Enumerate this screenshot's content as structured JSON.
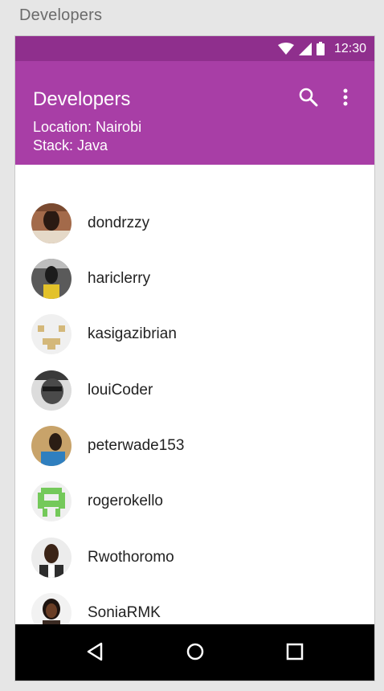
{
  "frame": {
    "title": "Developers"
  },
  "status_bar": {
    "time": "12:30",
    "icons": [
      "wifi-icon",
      "signal-icon",
      "battery-icon"
    ]
  },
  "app_bar": {
    "title": "Developers",
    "location": "Location: Nairobi",
    "stack": "Stack: Java",
    "actions": [
      "search-icon",
      "more-vert-icon"
    ],
    "color": "#a83ea6",
    "status_color": "#8f2f8d"
  },
  "developers": [
    {
      "username": "dondrzzy"
    },
    {
      "username": "hariclerry"
    },
    {
      "username": "kasigazibrian"
    },
    {
      "username": "louiCoder"
    },
    {
      "username": "peterwade153"
    },
    {
      "username": "rogerokello"
    },
    {
      "username": "Rwothoromo"
    },
    {
      "username": "SoniaRMK"
    }
  ],
  "nav_bar": {
    "buttons": [
      "back-icon",
      "home-icon",
      "recents-icon"
    ]
  }
}
